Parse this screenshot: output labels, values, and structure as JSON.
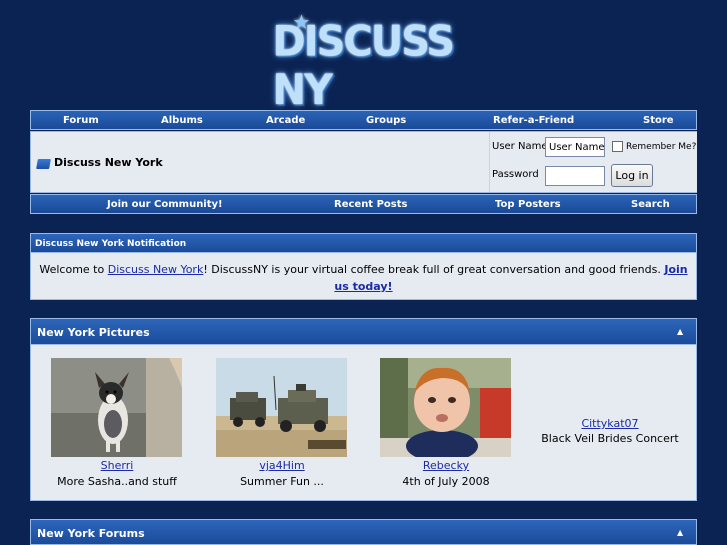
{
  "logo": {
    "text": "DISCUSS NY",
    "star": "★"
  },
  "nav_top": [
    "Forum",
    "Albums",
    "Arcade",
    "Groups",
    "Refer-a-Friend",
    "Store"
  ],
  "site_title": "Discuss New York",
  "login": {
    "username_label": "User Name",
    "username_value": "User Name",
    "remember_label": "Remember Me?",
    "password_label": "Password",
    "password_value": "",
    "button_label": "Log in"
  },
  "nav_bottom": [
    "Join our Community!",
    "Recent Posts",
    "Top Posters",
    "Search"
  ],
  "notification": {
    "title": "Discuss New York Notification",
    "text_before": "Welcome to ",
    "link": "Discuss New York",
    "text_after": "! DiscussNY is your virtual coffee break full of great conversation and good friends. ",
    "join_link": "Join us today!"
  },
  "pictures": {
    "title": "New York Pictures",
    "items": [
      {
        "user": "Sherri",
        "caption": "More Sasha..and stuff"
      },
      {
        "user": "vja4Him",
        "caption": "Summer Fun ..."
      },
      {
        "user": "Rebecky",
        "caption": "4th of July 2008"
      },
      {
        "user": "Cittykat07",
        "caption": "Black Veil Brides Concert"
      }
    ]
  },
  "forums": {
    "title": "New York Forums"
  },
  "colors": {
    "background": "#0b2352",
    "bar": "#1f529f",
    "panel": "#e6eaf1",
    "link": "#1a2aa8"
  }
}
